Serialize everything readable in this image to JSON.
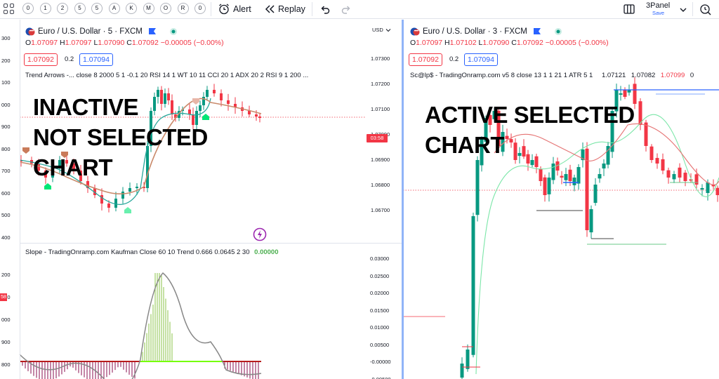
{
  "toolbar": {
    "intervals": [
      "0",
      "1",
      "2",
      "5",
      "5",
      "A",
      "K",
      "M",
      "O",
      "R",
      "0"
    ],
    "alert_label": "Alert",
    "replay_label": "Replay",
    "layout_name": "3Panel",
    "layout_save": "Save"
  },
  "left_chart": {
    "symbol_title": "Euro / U.S. Dollar · 5 · FXCM",
    "ohlc": {
      "o": "1.07097",
      "h": "1.07097",
      "l": "1.07090",
      "c": "1.07092",
      "change": "−0.00005 (−0.00%)"
    },
    "sell_price": "1.07092",
    "spread": "0.2",
    "buy_price": "1.07094",
    "currency": "USD",
    "indicator_legend": "Trend Arrows -... close 8 2000 5 1 -0.1 20 RSI 14 1 WT 10 11 CCI 20 1 ADX 20 2 RSI 9 1 200 ...",
    "countdown": "03:58",
    "price_axis": [
      "1.07300",
      "1.07200",
      "1.07100",
      "1.07000",
      "1.06900",
      "1.06800",
      "1.06700"
    ],
    "left_edge_ticks": [
      "300",
      "200",
      "100",
      "000",
      "900",
      "800",
      "700",
      "600",
      "500",
      "400"
    ],
    "annotation": [
      "INACTIVE",
      "NOT SELECTED",
      "CHART"
    ]
  },
  "slope_pane": {
    "legend": "Slope - TradingOnramp.com Kaufman Close 60 10 Trend 0.666 0.0645 2 30",
    "value": "0.00000",
    "axis": [
      "0.03000",
      "0.02500",
      "0.02000",
      "0.01500",
      "0.01000",
      "0.00500",
      "-0.00000",
      "-0.00500"
    ],
    "left_edge_ticks": [
      "200",
      "100",
      "000",
      "900",
      "800"
    ],
    "left_edge_badge": "58"
  },
  "right_chart": {
    "symbol_title": "Euro / U.S. Dollar · 3 · FXCM",
    "ohlc": {
      "o": "1.07097",
      "h": "1.07102",
      "l": "1.07090",
      "c": "1.07092",
      "change": "−0.00005 (−0.00%)"
    },
    "sell_price": "1.07092",
    "spread": "0.2",
    "buy_price": "1.07094",
    "indicator_legend": "Sc@lp$ - TradingOnramp.com v5 8 close 13 1 1 21 1 ATR 5 1",
    "indicator_values": [
      "1.07121",
      "1.07082"
    ],
    "indicator_value_red": "1.07099",
    "indicator_trailing": "0",
    "annotation": [
      "ACTIVE SELECTED",
      "CHART"
    ]
  },
  "colors": {
    "up": "#089981",
    "down": "#f23645",
    "accent": "#2962ff",
    "active_border": "#90b4f8",
    "annotation_text": "#000000"
  }
}
